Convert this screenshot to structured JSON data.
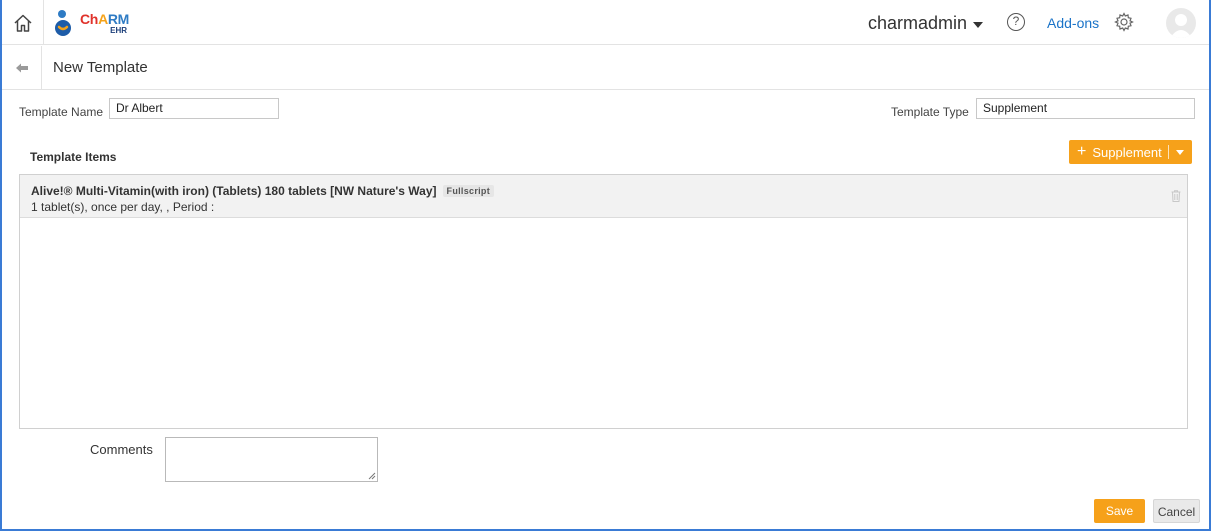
{
  "header": {
    "logo": {
      "text_ch": "Ch",
      "text_a": "A",
      "text_rm": "RM",
      "sub": "EHR"
    },
    "user_name": "charmadmin",
    "help_symbol": "?",
    "addons_label": "Add-ons",
    "icons": [
      "home-icon",
      "help-icon",
      "gear-icon",
      "avatar"
    ]
  },
  "page": {
    "title": "New Template",
    "back_icon": "arrow-left-icon"
  },
  "form": {
    "template_name_label": "Template Name",
    "template_name_value": "Dr Albert",
    "template_type_label": "Template Type",
    "template_type_value": "Supplement"
  },
  "items_section": {
    "title": "Template Items",
    "add_button_label": "Supplement",
    "items": [
      {
        "title": "Alive!® Multi-Vitamin(with iron) (Tablets) 180 tablets [NW Nature's Way]",
        "badge": "Fullscript",
        "detail": "1 tablet(s), once per day, ,  Period :"
      }
    ]
  },
  "comments": {
    "label": "Comments",
    "value": ""
  },
  "actions": {
    "save_label": "Save",
    "cancel_label": "Cancel"
  },
  "colors": {
    "accent_orange": "#f6a11a",
    "link_blue": "#1a73c8",
    "frame_blue": "#3a7bd5"
  }
}
